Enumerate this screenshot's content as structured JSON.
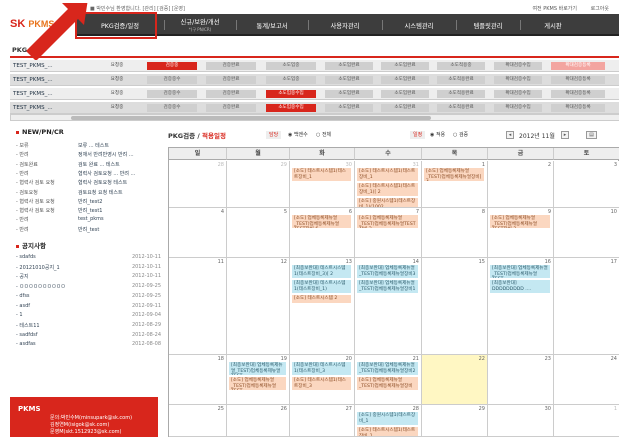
{
  "app": {
    "logo_sk": "SK",
    "logo_pkms": "PKMS"
  },
  "top_links": {
    "left": "■ 박민수님 환영합니다. [관리] [검증] [운영]",
    "right": [
      "여전 PKMS 바로가기",
      "로그아웃"
    ]
  },
  "nav": [
    {
      "label": "PKG검증/일정",
      "sub": ""
    },
    {
      "label": "신규/보완/개선",
      "sub": "*(구 PN/CR)"
    },
    {
      "label": "통계/보고서",
      "sub": ""
    },
    {
      "label": "사용자관리",
      "sub": ""
    },
    {
      "label": "시스템관리",
      "sub": ""
    },
    {
      "label": "템플릿관리",
      "sub": ""
    },
    {
      "label": "게시판",
      "sub": ""
    }
  ],
  "pkg_status": {
    "title_prefix": "PKG ",
    "title_accent": "현황",
    "rows": [
      {
        "name": "TEST_PKMS_...",
        "cells": [
          "요청중",
          "검증중",
          "검증완료",
          "소도입중",
          "소도입완료",
          "소도입완료",
          "소도적용중",
          "확대검증수입",
          "확대검증등록"
        ],
        "states": [
          "plain",
          "active",
          "done",
          "done",
          "done",
          "done",
          "done",
          "done",
          "pink"
        ]
      },
      {
        "name": "TEST_PKMS_...",
        "cells": [
          "요청중",
          "검증중수",
          "검증완료",
          "소도입중",
          "소도입완료",
          "소도입완료",
          "소도적용완료",
          "확대검증수입",
          "확대검증등록"
        ],
        "states": [
          "plain",
          "done",
          "done",
          "done",
          "done",
          "done",
          "done",
          "done",
          "done"
        ]
      },
      {
        "name": "TEST_PKMS_...",
        "cells": [
          "요청중",
          "검증중수",
          "검증완료",
          "소도입중수입",
          "소도입완료",
          "소도입완료",
          "소도적용완료",
          "확대검증수입",
          "확대검증등록"
        ],
        "states": [
          "plain",
          "done",
          "done",
          "active",
          "done",
          "done",
          "done",
          "done",
          "done"
        ]
      },
      {
        "name": "TEST_PKMS_...",
        "cells": [
          "요청중",
          "검증중수",
          "검증완료",
          "소도입중수입",
          "소도입완료",
          "소도입완료",
          "소도적용완료",
          "확대검증수입",
          "확대검증등록"
        ],
        "states": [
          "plain",
          "done",
          "done",
          "active",
          "done",
          "done",
          "done",
          "done",
          "done"
        ]
      }
    ]
  },
  "newpn": {
    "title": "NEW/PN/CR",
    "rows": [
      {
        "type": "- 보류",
        "desc": "보류 ... 테스트"
      },
      {
        "type": "- 반려",
        "desc": "정재서 반려반영시 반려 ..."
      },
      {
        "type": "- 검토완료",
        "desc": "검토 완료 ... 테스트"
      },
      {
        "type": "- 반려",
        "desc": "협력사 검토요청 ... 반려 ..."
      },
      {
        "type": "- 협력사 검토 요청",
        "desc": "협력사 검토요청 테스트"
      },
      {
        "type": "- 검토요청",
        "desc": "검토요청 요청 테스트"
      },
      {
        "type": "- 협력사 검토 요청",
        "desc": "반려_test2"
      },
      {
        "type": "- 협력사 검토 요청",
        "desc": "반려_test1"
      },
      {
        "type": "- 반려",
        "desc": "test_pkms"
      },
      {
        "type": "- 반려",
        "desc": "반려_test"
      }
    ]
  },
  "notice": {
    "title": "공지사항",
    "rows": [
      {
        "title": "- sdafds",
        "date": "2012-10-11"
      },
      {
        "title": "- 20121010공지_1",
        "date": "2012-10-11"
      },
      {
        "title": "- 공지",
        "date": "2012-10-11"
      },
      {
        "title": "- ㅁㅁㅁㅁㅁㅁㅁㅁㅁㅁ",
        "date": "2012-09-25"
      },
      {
        "title": "- dfss",
        "date": "2012-09-25"
      },
      {
        "title": "- asdf",
        "date": "2012-09-11"
      },
      {
        "title": "- 1",
        "date": "2012-09-04"
      },
      {
        "title": "- 테스트11",
        "date": "2012-08-29"
      },
      {
        "title": "- sadfdsf",
        "date": "2012-08-24"
      },
      {
        "title": "- asdfas",
        "date": "2012-08-08"
      }
    ]
  },
  "contact": {
    "brand": "PKMS",
    "lines": [
      "문의:박민수M(minsupark@sk.com)",
      "김정연M(isigok@sk.com)",
      "문영M(skt.1512923@sk.com)"
    ]
  },
  "calendar": {
    "title_prefix": "PKG검증 / ",
    "title_accent": "적용일정",
    "filter_label": "담당",
    "filter_opts": [
      "백엔수",
      "전체"
    ],
    "sched_label": "일정",
    "sched_opts": [
      "적용",
      "검증"
    ],
    "month_label": "2012년 11월",
    "prev": "◂",
    "next": "▸",
    "dow": [
      "일",
      "월",
      "화",
      "수",
      "목",
      "금",
      "토"
    ],
    "weeks": [
      [
        {
          "n": "28",
          "out": true
        },
        {
          "n": "29",
          "out": true
        },
        {
          "n": "30",
          "out": true
        },
        {
          "n": "31",
          "out": true
        },
        {
          "n": "1"
        },
        {
          "n": "2"
        },
        {
          "n": "3"
        }
      ],
      [
        {
          "n": "4"
        },
        {
          "n": "5"
        },
        {
          "n": "6"
        },
        {
          "n": "7"
        },
        {
          "n": "8"
        },
        {
          "n": "9"
        },
        {
          "n": "10"
        }
      ],
      [
        {
          "n": "11"
        },
        {
          "n": "12"
        },
        {
          "n": "13"
        },
        {
          "n": "14"
        },
        {
          "n": "15"
        },
        {
          "n": "16"
        },
        {
          "n": "17"
        }
      ],
      [
        {
          "n": "18"
        },
        {
          "n": "19"
        },
        {
          "n": "20"
        },
        {
          "n": "21"
        },
        {
          "n": "22",
          "today": true
        },
        {
          "n": "23"
        },
        {
          "n": "24"
        }
      ],
      [
        {
          "n": "25"
        },
        {
          "n": "26"
        },
        {
          "n": "27"
        },
        {
          "n": "28"
        },
        {
          "n": "29"
        },
        {
          "n": "30"
        },
        {
          "n": "1",
          "out": true
        }
      ]
    ],
    "events": {
      "0-2": [
        {
          "c": "orange",
          "t": "[소도] 테스트시스템1(테스트장비_1"
        }
      ],
      "0-3": [
        {
          "c": "orange",
          "t": "[소도] 테스트시스템1(테스트장비_1"
        },
        {
          "c": "orange",
          "t": "[소도] 테스트시스템1(테스트장비_1)[ 2"
        },
        {
          "c": "orange",
          "t": "[소도] 중원시스템1(테스트장비_1)(1002"
        }
      ],
      "0-4": [
        {
          "c": "orange",
          "t": "[소도] 업체등록제뉴얼_TEST)업체등록제뉴얼장비] 4"
        }
      ],
      "1-2": [
        {
          "c": "orange",
          "t": "[소도] 업체등록제뉴얼_TEST)업체등록제뉴얼TEST장비 6"
        }
      ],
      "1-3": [
        {
          "c": "orange",
          "t": "[소도] 업체등록제뉴얼_TEST)업체등록제뉴얼TEST장비 2"
        }
      ],
      "1-5": [
        {
          "c": "orange",
          "t": "[소도] 업체등록제뉴얼_TEST)업체등록제뉴얼TEST장비 2"
        }
      ],
      "2-2": [
        {
          "c": "blue",
          "t": "[최종보완대] 테스트시스템1(테스트장비_3)[ 2"
        },
        {
          "c": "blue",
          "t": "[최종보완대] 테스트시스템1(테스트장비_1)"
        },
        {
          "c": "orange",
          "t": "[소도] 테스트시스템 2"
        }
      ],
      "2-3": [
        {
          "c": "blue",
          "t": "[최종보완대] 업체등록제뉴얼_TEST)업체등록제뉴얼장비3"
        },
        {
          "c": "blue",
          "t": "[최종보완대] 업체등록제뉴얼_TEST)업체등록제뉴얼장비1"
        }
      ],
      "2-5": [
        {
          "c": "blue",
          "t": "[최종보완대] 업체등록제뉴얼_TEST)업체등록제뉴얼TEST"
        },
        {
          "c": "blue",
          "t": "[최종보완대] DDDDDDDDD ...."
        }
      ],
      "3-1": [
        {
          "c": "blue",
          "t": "[최종보완대] 업체등록제뉴얼_TEST)업체등록제뉴얼TEST"
        },
        {
          "c": "orange",
          "t": "[소도] 업체등록제뉴얼_TEST)업체등록제뉴얼TEST"
        }
      ],
      "3-2": [
        {
          "c": "blue",
          "t": "[최종보완대] 테스트시스템1(테스트장비_3"
        },
        {
          "c": "orange",
          "t": "[소도] 테스트시스템1(테스트장비_3"
        }
      ],
      "3-3": [
        {
          "c": "blue",
          "t": "[최종보완대] 업체등록제뉴얼_TEST)업체등록제뉴얼장비2"
        },
        {
          "c": "orange",
          "t": "[소도] 업체등록제뉴얼_TEST)업체등록제뉴얼장비"
        }
      ],
      "4-3": [
        {
          "c": "blue",
          "t": "[소도] 중원시스템1(테스트장비_1"
        },
        {
          "c": "orange",
          "t": "[소도] 테스트시스템1(테스트장비_1"
        }
      ]
    }
  }
}
